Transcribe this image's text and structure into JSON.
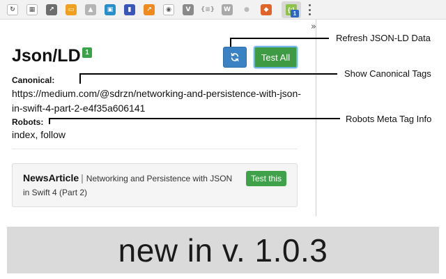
{
  "toolbar": {
    "icons": [
      {
        "name": "ext-icon-1",
        "glyph": "↻",
        "color": "#555555",
        "style": "outlined"
      },
      {
        "name": "ext-icon-2",
        "glyph": "▦",
        "color": "#555555",
        "style": "outlined"
      },
      {
        "name": "ext-icon-3",
        "glyph": "↗",
        "color": "#6d6d6d",
        "style": "filled"
      },
      {
        "name": "ext-icon-4",
        "glyph": "▭",
        "color": "#f0a020",
        "style": "filled"
      },
      {
        "name": "ext-icon-5",
        "glyph": "▲",
        "color": "#b5b5b5",
        "style": "filled"
      },
      {
        "name": "ext-icon-6",
        "glyph": "▣",
        "color": "#2a8fc9",
        "style": "filled"
      },
      {
        "name": "ext-icon-7",
        "glyph": "▮",
        "color": "#3a56b8",
        "style": "filled"
      },
      {
        "name": "ext-icon-8",
        "glyph": "↗",
        "color": "#f08a1c",
        "style": "filled"
      },
      {
        "name": "ext-icon-9",
        "glyph": "◉",
        "color": "#555555",
        "style": "outlined"
      },
      {
        "name": "ext-icon-10",
        "glyph": "V",
        "color": "#8a8a8a",
        "style": "filled"
      },
      {
        "name": "ext-icon-11",
        "glyph": "{≡}",
        "color": "#9a9a9a",
        "style": "text"
      },
      {
        "name": "ext-icon-12",
        "glyph": "W",
        "color": "#a9a9a9",
        "style": "filled"
      },
      {
        "name": "ext-icon-13",
        "glyph": "●",
        "color": "#bbbbbb",
        "style": "text"
      },
      {
        "name": "ext-icon-14",
        "glyph": "◆",
        "color": "#e0632a",
        "style": "filled"
      }
    ],
    "active_icon_glyph": "{;}",
    "active_badge": "1"
  },
  "popup": {
    "title": "Json/LD",
    "title_badge": "1",
    "test_all_label": "Test All",
    "canonical_label": "Canonical:",
    "canonical_value": "https://medium.com/@sdrzn/networking-and-persistence-with-json-in-swift-4-part-2-e4f35a606141",
    "robots_label": "Robots:",
    "robots_value": "index, follow",
    "overflow_glyph": "»",
    "card": {
      "type": "NewsArticle",
      "separator": "|",
      "headline": "Networking and Persistence with JSON in Swift 4 (Part 2)",
      "test_this_label": "Test this"
    }
  },
  "annotations": {
    "refresh": "Refresh JSON-LD Data",
    "canonical": "Show Canonical Tags",
    "robots": "Robots Meta Tag Info"
  },
  "banner": {
    "text": "new in v. 1.0.3"
  },
  "colors": {
    "refresh_button": "#3b82c4",
    "test_all_button": "#3f9a44",
    "test_this_button": "#3fa14a",
    "badge": "#3aa347",
    "banner_bg": "#dadada"
  }
}
